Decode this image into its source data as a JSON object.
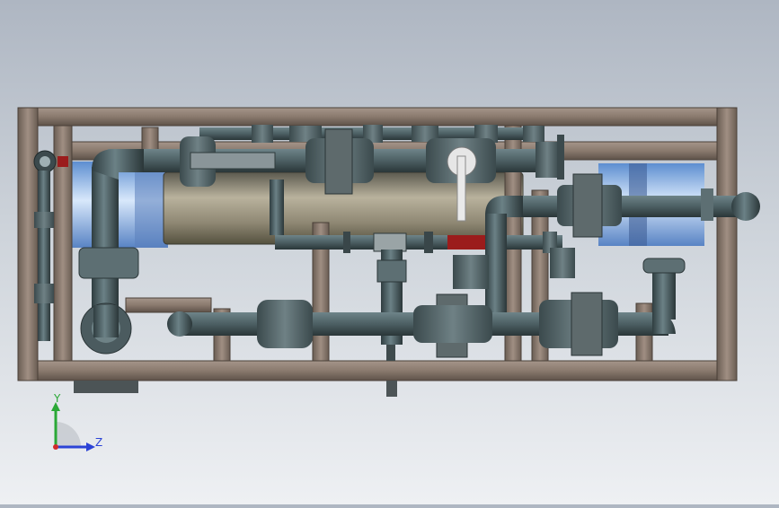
{
  "viewport": {
    "background_top": "#aeb6c2",
    "background_bottom": "#eef0f3",
    "model": {
      "frame_color": "#8c7b6e",
      "pipe_color": "#4f6266",
      "vessel_color": "#a9a28f",
      "membrane_color": "#7fb0e6",
      "valve_accent": "#9b1c1c",
      "valve_handle": "#e8e8e8"
    }
  },
  "triad": {
    "y_label": "Y",
    "z_label": "Z",
    "y_color": "#2aa836",
    "z_color": "#2b43d6",
    "x_color": "#d12b2b"
  }
}
